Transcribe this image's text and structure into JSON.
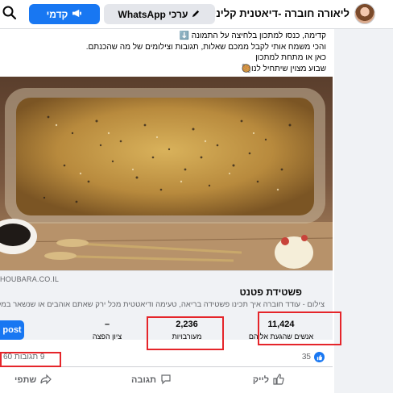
{
  "header": {
    "page_name": "ליאורה חוברה -דיאטנית קלינית ו...",
    "whatsapp_button": "ערכי WhatsApp",
    "boost_button": "קדמי"
  },
  "post": {
    "text_lines": [
      "קדימה, כנסו למתכון בלחיצה על התמונה ⬇️",
      "והכי משמח אותי לקבל ממכם שאלות, תגובות וצילומים של מה שהכנתם.",
      "כאן או מתחת למתכון",
      "שבוע מצוין שיתחיל לנו🥘"
    ]
  },
  "link": {
    "domain": "HOUBARA.CO.IL",
    "title": "פשטידת פטנט",
    "description": "צילום - עודד חוברה איך תכינו פשטידה בריאה, טעימה ודיאטטית מכל ירק שאתם אוהבים או שנשאר במקרר"
  },
  "insights": {
    "reach_value": "11,424",
    "reach_label": "אנשים שהגעת אליהם",
    "engagement_value": "2,236",
    "engagement_label": "מעורבויות",
    "score_value": "–",
    "score_label": "ציון הפצה",
    "boost_post_label": "post"
  },
  "reactions": {
    "like_count": "35",
    "counts_text": "9 תגובות 60"
  },
  "actions": {
    "like": "לייק",
    "comment": "תגובה",
    "share": "שתפי"
  },
  "colors": {
    "accent": "#1877f2",
    "highlight": "#e5252a"
  }
}
